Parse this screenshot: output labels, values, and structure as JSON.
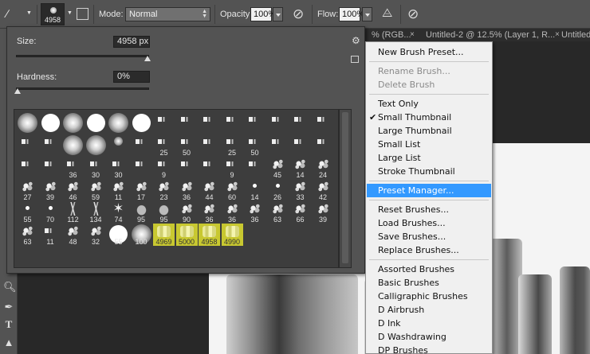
{
  "options_bar": {
    "brush_size_value": "4958",
    "mode_label": "Mode:",
    "mode_value": "Normal",
    "opacity_label": "Opacity:",
    "opacity_value": "100%",
    "flow_label": "Flow:",
    "flow_value": "100%"
  },
  "tabs": [
    {
      "label": "% (RGB..."
    },
    {
      "label": "Untitled-2 @ 12.5% (Layer 1, R..."
    },
    {
      "label": "Untitled"
    }
  ],
  "picker": {
    "size_label": "Size:",
    "size_value": "4958 px",
    "hardness_label": "Hardness:",
    "hardness_value": "0%",
    "size_fraction": 0.99,
    "hardness_fraction": 0.0
  },
  "brushes": [
    {
      "n": "",
      "t": "soft"
    },
    {
      "n": "",
      "t": "round"
    },
    {
      "n": "",
      "t": "soft"
    },
    {
      "n": "",
      "t": "round"
    },
    {
      "n": "",
      "t": "soft"
    },
    {
      "n": "",
      "t": "round"
    },
    {
      "n": "",
      "t": "chalk"
    },
    {
      "n": "",
      "t": "chalk"
    },
    {
      "n": "",
      "t": "chalk"
    },
    {
      "n": "",
      "t": "chalk"
    },
    {
      "n": "",
      "t": "chalk"
    },
    {
      "n": "",
      "t": "chalk"
    },
    {
      "n": "",
      "t": "chalk"
    },
    {
      "n": "",
      "t": "chalk"
    },
    {
      "n": "",
      "t": "chalk"
    },
    {
      "n": "",
      "t": "chalk"
    },
    {
      "n": "",
      "t": "soft"
    },
    {
      "n": "",
      "t": "soft"
    },
    {
      "n": "",
      "t": "soft-sm"
    },
    {
      "n": "",
      "t": "chalk"
    },
    {
      "n": "25",
      "t": "chalk"
    },
    {
      "n": "50",
      "t": "chalk"
    },
    {
      "n": "",
      "t": "chalk"
    },
    {
      "n": "25",
      "t": "chalk"
    },
    {
      "n": "50",
      "t": "chalk"
    },
    {
      "n": "",
      "t": "chalk"
    },
    {
      "n": "",
      "t": "chalk"
    },
    {
      "n": "",
      "t": "chalk"
    },
    {
      "n": "",
      "t": "chalk"
    },
    {
      "n": "",
      "t": "chalk"
    },
    {
      "n": "36",
      "t": "chalk"
    },
    {
      "n": "30",
      "t": "chalk"
    },
    {
      "n": "30",
      "t": "chalk"
    },
    {
      "n": "",
      "t": "chalk"
    },
    {
      "n": "9",
      "t": "chalk"
    },
    {
      "n": "",
      "t": "chalk"
    },
    {
      "n": "",
      "t": "chalk"
    },
    {
      "n": "9",
      "t": "chalk"
    },
    {
      "n": "",
      "t": "chalk"
    },
    {
      "n": "45",
      "t": "splat"
    },
    {
      "n": "14",
      "t": "splat"
    },
    {
      "n": "24",
      "t": "splat"
    },
    {
      "n": "27",
      "t": "splat"
    },
    {
      "n": "39",
      "t": "splat"
    },
    {
      "n": "46",
      "t": "splat"
    },
    {
      "n": "59",
      "t": "splat"
    },
    {
      "n": "11",
      "t": "splat"
    },
    {
      "n": "17",
      "t": "splat"
    },
    {
      "n": "23",
      "t": "splat"
    },
    {
      "n": "36",
      "t": "splat"
    },
    {
      "n": "44",
      "t": "splat"
    },
    {
      "n": "60",
      "t": "splat"
    },
    {
      "n": "14",
      "t": "dot"
    },
    {
      "n": "26",
      "t": "dot"
    },
    {
      "n": "33",
      "t": "splat"
    },
    {
      "n": "42",
      "t": "splat"
    },
    {
      "n": "55",
      "t": "dot"
    },
    {
      "n": "70",
      "t": "dot"
    },
    {
      "n": "112",
      "t": "grass"
    },
    {
      "n": "134",
      "t": "grass"
    },
    {
      "n": "74",
      "t": "star"
    },
    {
      "n": "95",
      "t": "leaf"
    },
    {
      "n": "95",
      "t": "leaf"
    },
    {
      "n": "90",
      "t": "splat"
    },
    {
      "n": "36",
      "t": "splat"
    },
    {
      "n": "36",
      "t": "splat"
    },
    {
      "n": "36",
      "t": "splat"
    },
    {
      "n": "63",
      "t": "splat"
    },
    {
      "n": "66",
      "t": "splat"
    },
    {
      "n": "39",
      "t": "splat"
    },
    {
      "n": "63",
      "t": "splat"
    },
    {
      "n": "11",
      "t": "chalk"
    },
    {
      "n": "48",
      "t": "splat"
    },
    {
      "n": "32",
      "t": "splat"
    },
    {
      "n": "55",
      "t": "round"
    },
    {
      "n": "100",
      "t": "soft"
    },
    {
      "n": "4969",
      "t": "wc",
      "sel": true
    },
    {
      "n": "5000",
      "t": "wc",
      "sel": true
    },
    {
      "n": "4958",
      "t": "wc",
      "sel": true
    },
    {
      "n": "4990",
      "t": "wc",
      "sel": true
    }
  ],
  "menu": {
    "items": [
      {
        "label": "New Brush Preset...",
        "state": "normal"
      },
      {
        "sep": true
      },
      {
        "label": "Rename Brush...",
        "state": "disabled"
      },
      {
        "label": "Delete Brush",
        "state": "disabled"
      },
      {
        "sep": true
      },
      {
        "label": "Text Only",
        "state": "normal"
      },
      {
        "label": "Small Thumbnail",
        "state": "checked"
      },
      {
        "label": "Large Thumbnail",
        "state": "normal"
      },
      {
        "label": "Small List",
        "state": "normal"
      },
      {
        "label": "Large List",
        "state": "normal"
      },
      {
        "label": "Stroke Thumbnail",
        "state": "normal"
      },
      {
        "sep": true
      },
      {
        "label": "Preset Manager...",
        "state": "highlighted"
      },
      {
        "sep": true
      },
      {
        "label": "Reset Brushes...",
        "state": "normal"
      },
      {
        "label": "Load Brushes...",
        "state": "normal"
      },
      {
        "label": "Save Brushes...",
        "state": "normal"
      },
      {
        "label": "Replace Brushes...",
        "state": "normal"
      },
      {
        "sep": true
      },
      {
        "label": "Assorted Brushes",
        "state": "normal"
      },
      {
        "label": "Basic Brushes",
        "state": "normal"
      },
      {
        "label": "Calligraphic Brushes",
        "state": "normal"
      },
      {
        "label": "D Airbrush",
        "state": "normal"
      },
      {
        "label": "D Ink",
        "state": "normal"
      },
      {
        "label": "D Washdrawing",
        "state": "normal"
      },
      {
        "label": "DP Brushes",
        "state": "normal"
      }
    ]
  },
  "colors": {
    "menu_highlight": "#3399ff",
    "selected_brush": "#c8c830"
  }
}
